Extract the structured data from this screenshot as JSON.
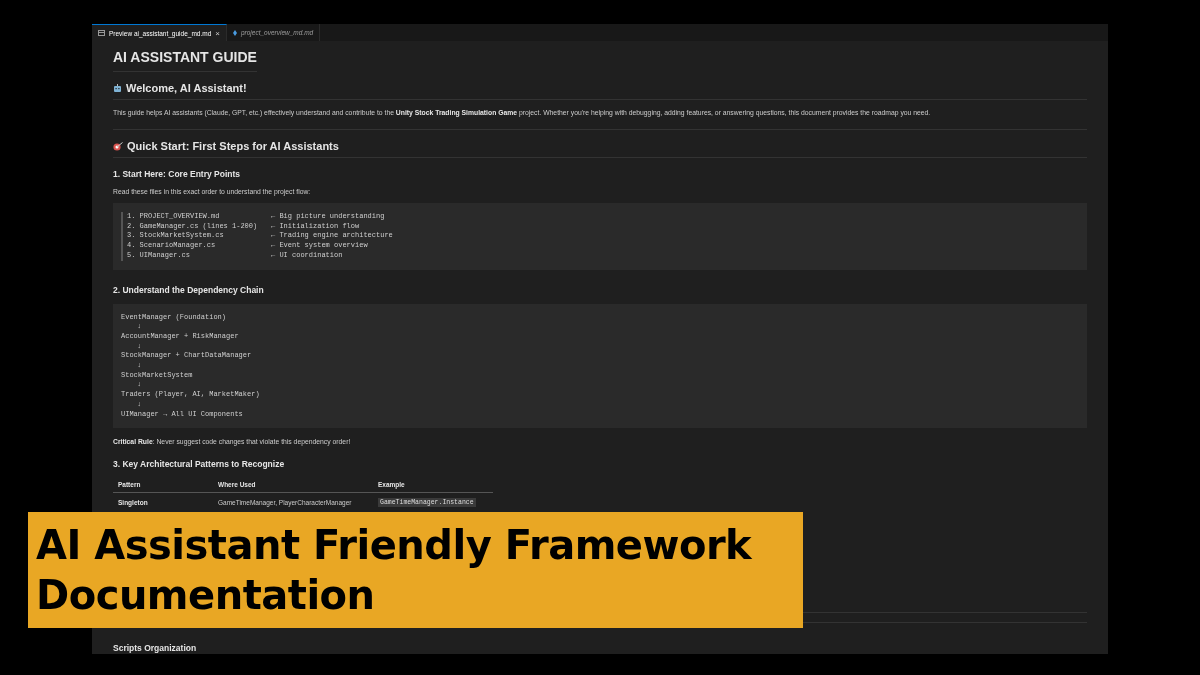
{
  "tabs": [
    {
      "label": "Preview ai_assistant_guide_md.md",
      "kind": "preview",
      "selected": true,
      "close": "×"
    },
    {
      "label": "project_overview_md.md",
      "kind": "markdown",
      "selected": false
    }
  ],
  "document": {
    "title": "AI ASSISTANT GUIDE",
    "welcome": {
      "heading": "Welcome, AI Assistant!",
      "text": "This guide helps AI assistants (Claude, GPT, etc.) effectively understand and contribute to the **Unity Stock Trading Simulation Game** project. Whether you're helping with debugging, adding features, or answering questions, this document provides the roadmap you need."
    },
    "quick_start": {
      "heading": "Quick Start: First Steps for AI Assistants",
      "step1": {
        "heading": "1. Start Here: Core Entry Points",
        "text": "Read these files in this exact order to understand the project flow:",
        "files": [
          {
            "file": "1. PROJECT_OVERVIEW.md",
            "note": "← Big picture understanding"
          },
          {
            "file": "2. GameManager.cs (lines 1-200)",
            "note": "← Initialization flow"
          },
          {
            "file": "3. StockMarketSystem.cs",
            "note": "← Trading engine architecture"
          },
          {
            "file": "4. ScenarioManager.cs",
            "note": "← Event system overview"
          },
          {
            "file": "5. UIManager.cs",
            "note": "← UI coordination"
          }
        ]
      },
      "step2": {
        "heading": "2. Understand the Dependency Chain",
        "chain": [
          {
            "kind": "node",
            "text": "EventManager (Foundation)"
          },
          {
            "kind": "arrow",
            "text": "↓"
          },
          {
            "kind": "node",
            "text": "AccountManager + RiskManager"
          },
          {
            "kind": "arrow",
            "text": "↓"
          },
          {
            "kind": "node",
            "text": "StockManager + ChartDataManager"
          },
          {
            "kind": "arrow",
            "text": "↓"
          },
          {
            "kind": "node",
            "text": "StockMarketSystem"
          },
          {
            "kind": "arrow",
            "text": "↓"
          },
          {
            "kind": "node",
            "text": "Traders (Player, AI, MarketMaker)"
          },
          {
            "kind": "arrow",
            "text": "↓"
          },
          {
            "kind": "node",
            "text": "UIManager → All UI Components"
          }
        ],
        "rule": "**Critical Rule**: Never suggest code changes that violate this dependency order!"
      },
      "step3": {
        "heading": "3. Key Architectural Patterns to Recognize",
        "table": {
          "columns": [
            "Pattern",
            "Where Used",
            "Example"
          ],
          "rows": [
            {
              "pattern": "Singleton",
              "where_used": "GameTimeManager, PlayerCharacterManager",
              "example": "GameTimeManager.Instance"
            }
          ]
        }
      }
    },
    "scripts_heading": "Scripts Organization"
  },
  "caption": {
    "lines": [
      "AI Assistant Friendly Framework",
      "Documentation"
    ]
  }
}
